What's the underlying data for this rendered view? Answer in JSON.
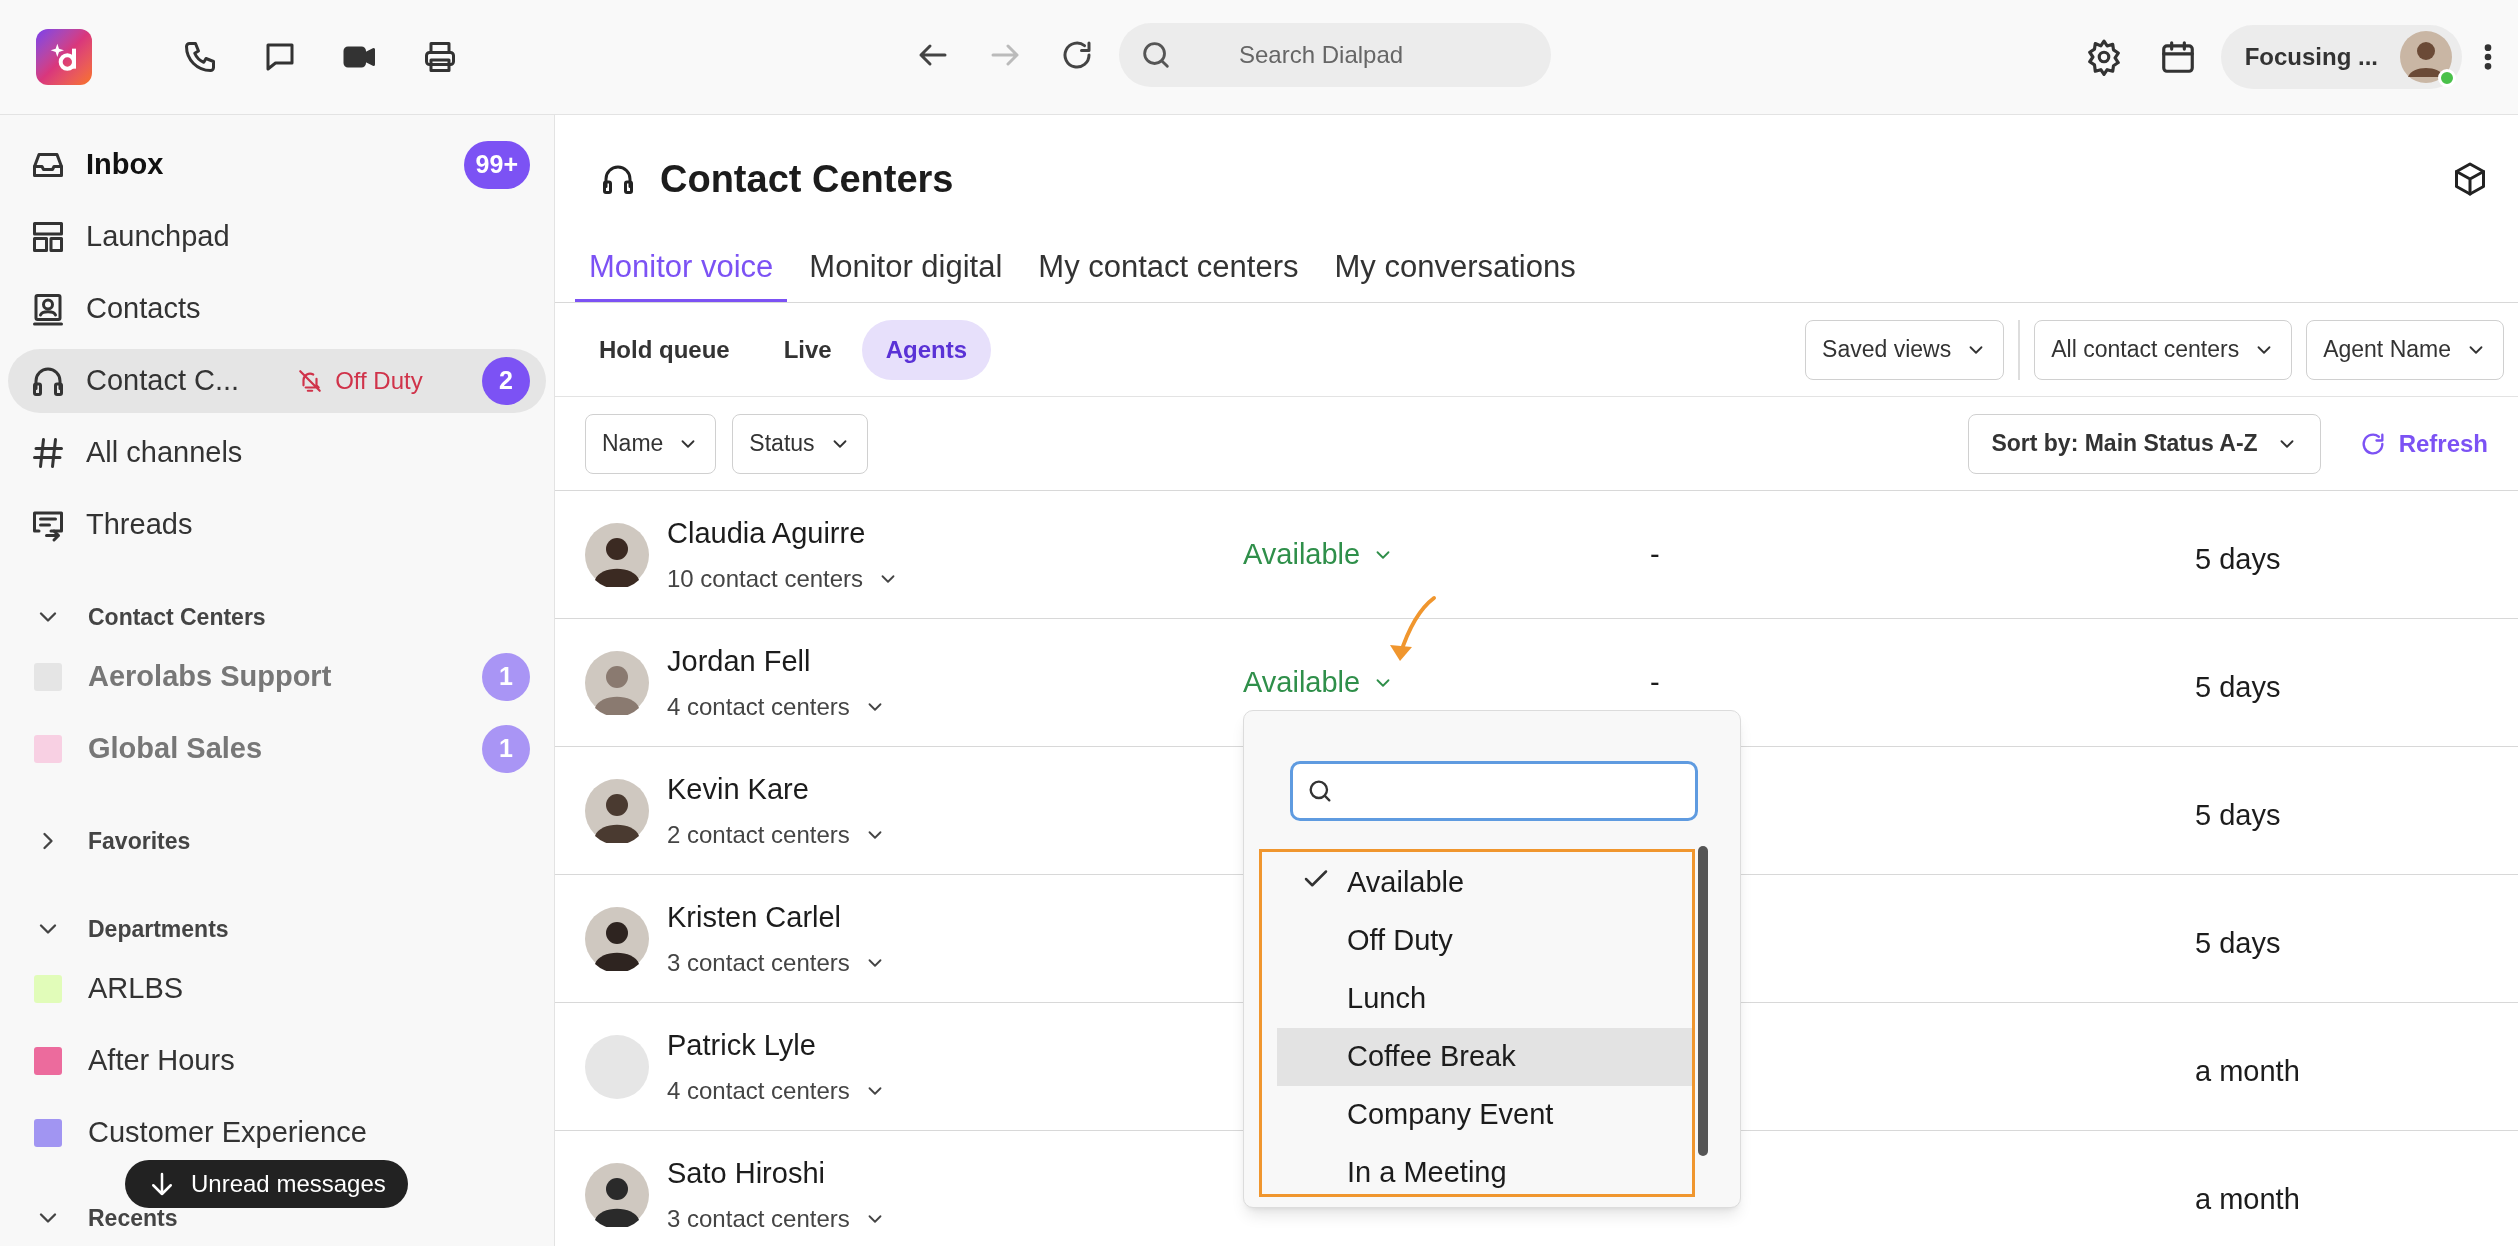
{
  "topbar": {
    "search_placeholder": "Search Dialpad",
    "status": "Focusing ...",
    "online": true
  },
  "sidebar": {
    "items": [
      {
        "label": "Inbox",
        "unread": true,
        "selected": false,
        "badge": "99+"
      },
      {
        "label": "Launchpad",
        "unread": false,
        "selected": false
      },
      {
        "label": "Contacts",
        "unread": false,
        "selected": false
      },
      {
        "label": "Contact C...",
        "unread": false,
        "selected": true,
        "status": "Off Duty",
        "badge": "2"
      },
      {
        "label": "All channels",
        "unread": false,
        "selected": false
      },
      {
        "label": "Threads",
        "unread": false,
        "selected": false
      }
    ],
    "sections": [
      {
        "title": "Contact Centers",
        "expanded": true,
        "items": [
          {
            "label": "Aerolabs Support",
            "color": "#e5e5e5",
            "badge": "1"
          },
          {
            "label": "Global Sales",
            "color": "#f8d0e3",
            "badge": "1"
          }
        ]
      },
      {
        "title": "Favorites",
        "expanded": false
      },
      {
        "title": "Departments",
        "expanded": true,
        "items": [
          {
            "label": "ARLBS",
            "color": "#e1fcb9"
          },
          {
            "label": "After Hours",
            "color": "#ec6b9d"
          },
          {
            "label": "Customer Experience",
            "color": "#a195f2"
          }
        ]
      },
      {
        "title": "Recents",
        "expanded": true
      }
    ],
    "toast": "Unread messages"
  },
  "page": {
    "title": "Contact Centers",
    "tabs": [
      {
        "label": "Monitor voice",
        "selected": true
      },
      {
        "label": "Monitor digital",
        "selected": false
      },
      {
        "label": "My contact centers",
        "selected": false
      },
      {
        "label": "My conversations",
        "selected": false
      }
    ],
    "subtabs": [
      {
        "label": "Hold queue",
        "selected": false
      },
      {
        "label": "Live",
        "selected": false
      },
      {
        "label": "Agents",
        "selected": true
      }
    ],
    "view_filters": [
      "Saved views",
      "All contact centers",
      "Agent Name"
    ],
    "column_filters": [
      "Name",
      "Status"
    ],
    "sort": "Sort by: Main Status A-Z",
    "refresh": "Refresh"
  },
  "agents": [
    {
      "name": "Claudia Aguirre",
      "centers": "10 contact centers",
      "kind": "picture",
      "status": "Available",
      "column_3": "-",
      "column_4": "5 days"
    },
    {
      "name": "Jordan Fell",
      "centers": "4 contact centers",
      "kind": "picture",
      "status": "Available",
      "column_3": "-",
      "column_4": "5 days"
    },
    {
      "name": "Kevin Kare",
      "centers": "2 contact centers",
      "kind": "picture",
      "column_4": "5 days"
    },
    {
      "name": "Kristen Carlel",
      "centers": "3 contact centers",
      "kind": "picture",
      "column_4": "5 days"
    },
    {
      "name": "Patrick Lyle",
      "centers": "4 contact centers",
      "kind": "placeholder",
      "column_4": "a month"
    },
    {
      "name": "Sato Hiroshi",
      "centers": "3 contact centers",
      "kind": "picture",
      "column_4": "a month"
    }
  ],
  "status_menu": {
    "options": [
      {
        "label": "Available",
        "checked": true,
        "highlighted": false
      },
      {
        "label": "Off Duty",
        "checked": false,
        "highlighted": false
      },
      {
        "label": "Lunch",
        "checked": false,
        "highlighted": false
      },
      {
        "label": "Coffee Break",
        "checked": false,
        "highlighted": true
      },
      {
        "label": "Company Event",
        "checked": false,
        "highlighted": false
      },
      {
        "label": "In a Meeting",
        "checked": false,
        "highlighted": false
      }
    ]
  }
}
